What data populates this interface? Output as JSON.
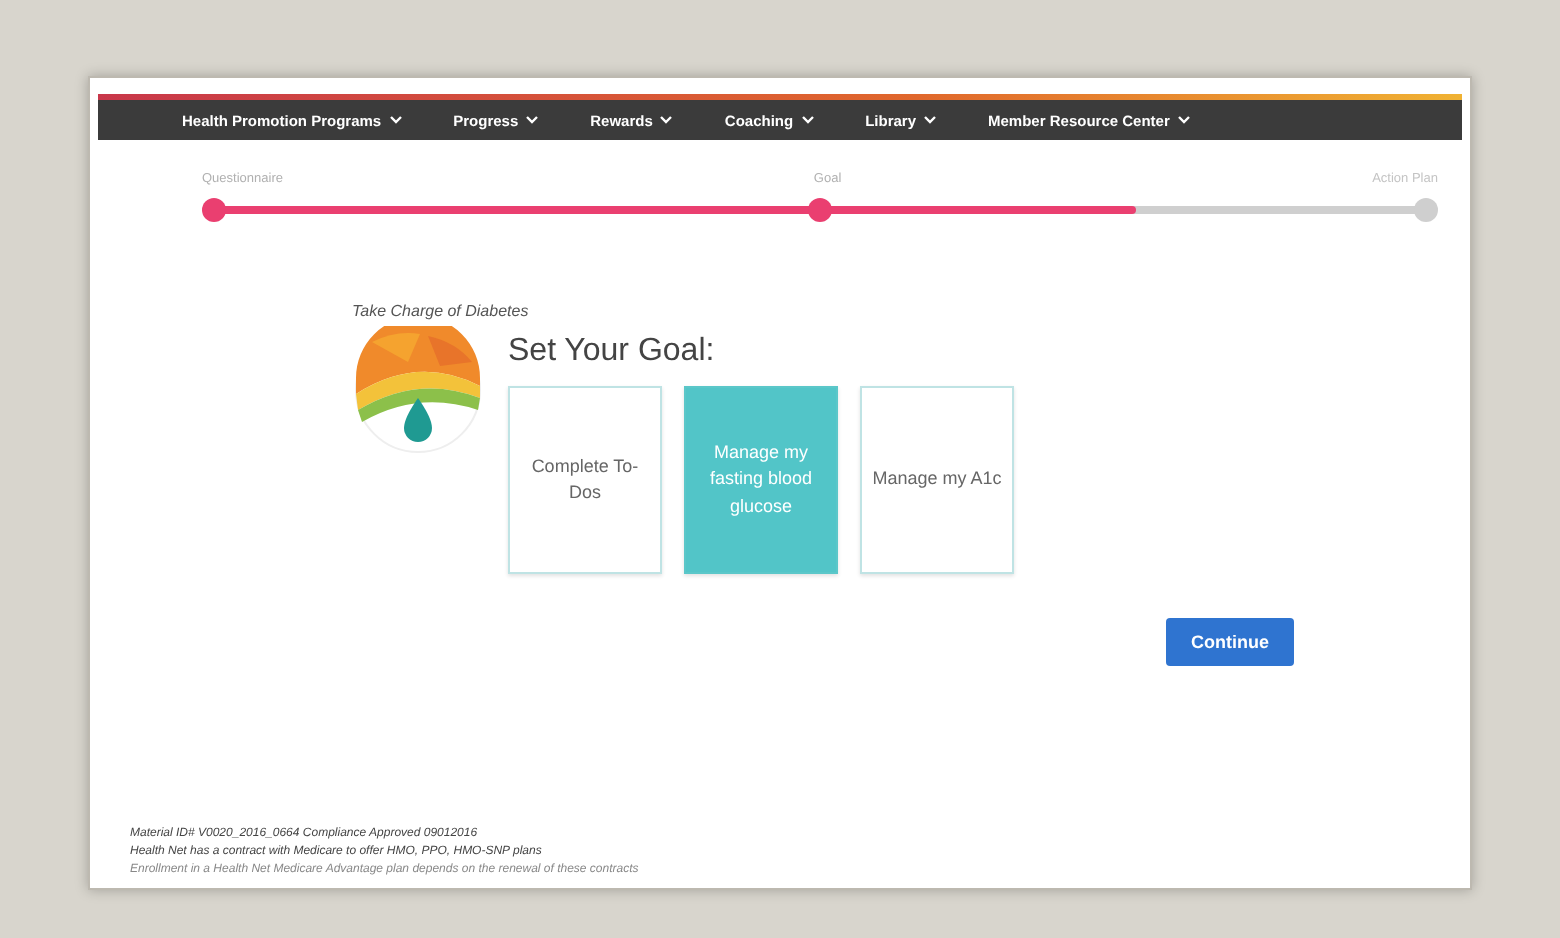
{
  "nav": {
    "items": [
      {
        "label": "Health Promotion Programs"
      },
      {
        "label": "Progress"
      },
      {
        "label": "Rewards"
      },
      {
        "label": "Coaching"
      },
      {
        "label": "Library"
      },
      {
        "label": "Member Resource Center"
      }
    ]
  },
  "stepper": {
    "level": 0.76,
    "steps": [
      {
        "label": "Questionnaire",
        "completed": true
      },
      {
        "label": "Goal",
        "completed": true
      },
      {
        "label": "Action Plan",
        "completed": false
      }
    ]
  },
  "program_title": "Take Charge of Diabetes",
  "heading": "Set Your Goal:",
  "goals": [
    {
      "label": "Complete To-Dos",
      "selected": false
    },
    {
      "label": "Manage my fasting blood glucose",
      "selected": true
    },
    {
      "label": "Manage my A1c",
      "selected": false
    }
  ],
  "continue_button": "Continue",
  "footer": [
    "Material ID# V0020_2016_0664 Compliance Approved 09012016",
    "Health Net has a contract with Medicare to offer HMO, PPO, HMO-SNP plans",
    "Enrollment in a Health Net Medicare Advantage plan depends on the renewal of these contracts"
  ]
}
